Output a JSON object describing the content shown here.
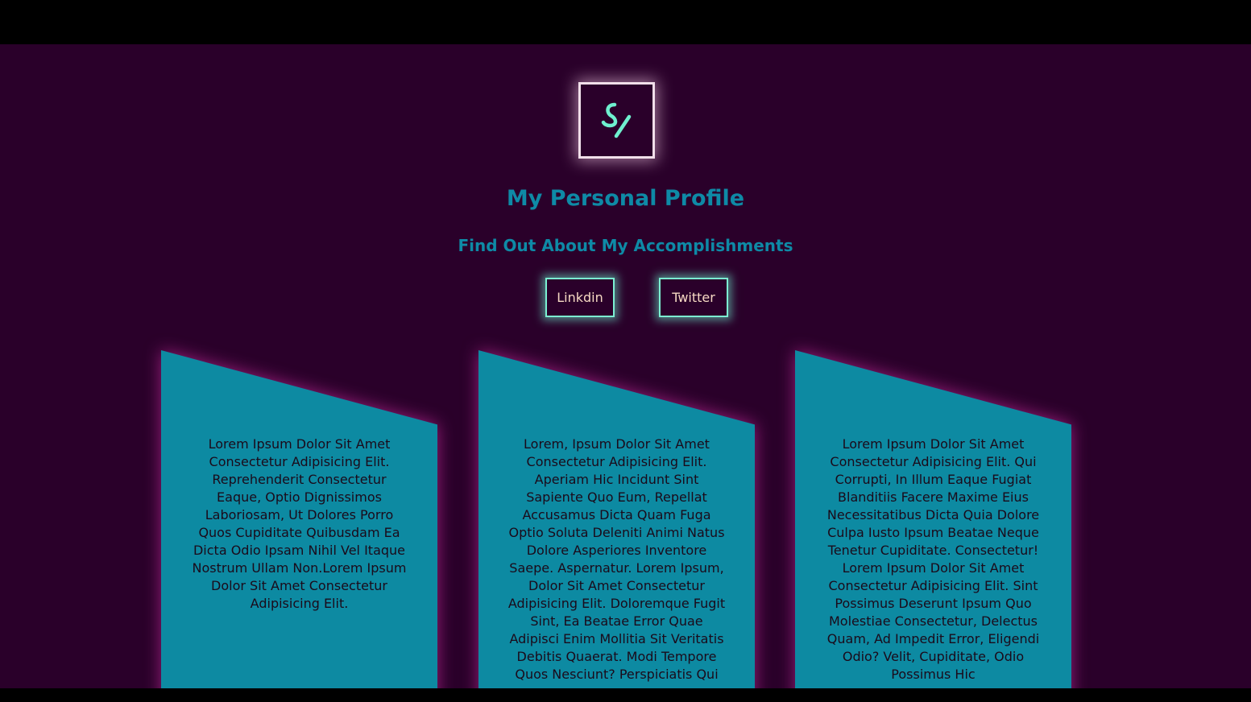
{
  "header": {
    "title": "My Personal Profile",
    "subtitle": "Find Out About My Accomplishments",
    "logo_icon": "sj-monogram-icon"
  },
  "social": {
    "linkedin_label": "Linkdin",
    "twitter_label": "Twitter"
  },
  "cards": [
    {
      "text": "Lorem Ipsum Dolor Sit Amet Consectetur Adipisicing Elit. Reprehenderit Consectetur Eaque, Optio Dignissimos Laboriosam, Ut Dolores Porro Quos Cupiditate Quibusdam Ea Dicta Odio Ipsam Nihil Vel Itaque Nostrum Ullam Non.Lorem Ipsum Dolor Sit Amet Consectetur Adipisicing Elit."
    },
    {
      "text": "Lorem, Ipsum Dolor Sit Amet Consectetur Adipisicing Elit. Aperiam Hic Incidunt Sint Sapiente Quo Eum, Repellat Accusamus Dicta Quam Fuga Optio Soluta Deleniti Animi Natus Dolore Asperiores Inventore Saepe. Aspernatur. Lorem Ipsum, Dolor Sit Amet Consectetur Adipisicing Elit. Doloremque Fugit Sint, Ea Beatae Error Quae Adipisci Enim Mollitia Sit Veritatis Debitis Quaerat. Modi Tempore Quos Nesciunt? Perspiciatis Qui"
    },
    {
      "text": "Lorem Ipsum Dolor Sit Amet Consectetur Adipisicing Elit. Qui Corrupti, In Illum Eaque Fugiat Blanditiis Facere Maxime Eius Necessitatibus Dicta Quia Dolore Culpa Iusto Ipsum Beatae Neque Tenetur Cupiditate. Consectetur! Lorem Ipsum Dolor Sit Amet Consectetur Adipisicing Elit. Sint Possimus Deserunt Ipsum Quo Molestiae Consectetur, Delectus Quam, Ad Impedit Error, Eligendi Odio? Velit, Cupiditate, Odio Possimus Hic"
    }
  ],
  "colors": {
    "background": "#2a002a",
    "accent": "#0e8aa6",
    "card": "#0d8aa2",
    "glow": "#7cf0d2",
    "button_text": "#f6d9c3"
  }
}
